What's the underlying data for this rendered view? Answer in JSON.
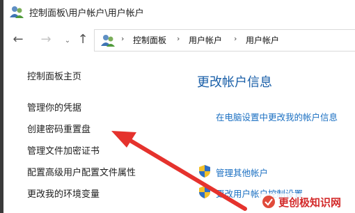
{
  "window": {
    "title": "控制面板\\用户帐户\\用户帐户"
  },
  "address": {
    "crumbs": [
      "控制面板",
      "用户帐户",
      "用户帐户"
    ]
  },
  "sidebar": {
    "items": [
      {
        "label": "控制面板主页"
      },
      {
        "label": "管理你的凭据"
      },
      {
        "label": "创建密码重置盘"
      },
      {
        "label": "管理文件加密证书"
      },
      {
        "label": "配置高级用户配置文件属性"
      },
      {
        "label": "更改我的环境变量"
      }
    ]
  },
  "main": {
    "title": "更改帐户信息",
    "links": [
      {
        "label": "在电脑设置中更改我的帐户信息"
      },
      {
        "label": "管理其他帐户"
      },
      {
        "label": "更改用户帐户控制设置"
      }
    ]
  },
  "watermark": {
    "text": "更创极知识网"
  },
  "colors": {
    "link": "#1a6fc2",
    "heading": "#1a5fa8",
    "annotation_arrow": "#e5322d",
    "watermark_text": "#d32b2b"
  },
  "icons": [
    "users-icon",
    "back-arrow-icon",
    "forward-arrow-icon",
    "chevron-down-icon",
    "up-arrow-icon",
    "uac-shield-icon"
  ]
}
